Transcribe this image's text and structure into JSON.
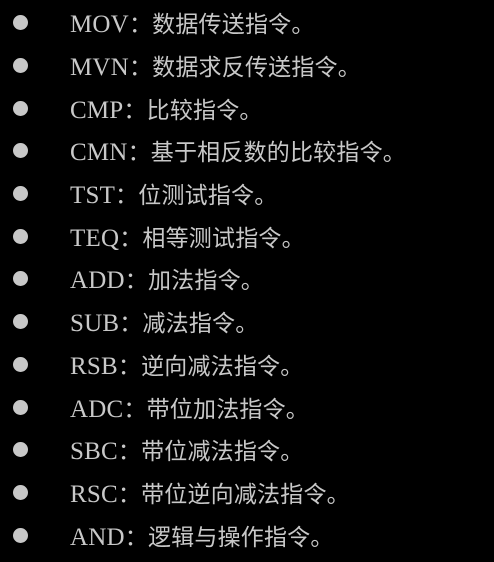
{
  "colors": {
    "background": "#000000",
    "text": "#c8c8c8",
    "bullet": "#c8c8c8"
  },
  "items": [
    {
      "mnemonic": "MOV",
      "sep": "：",
      "desc": "数据传送指令。"
    },
    {
      "mnemonic": "MVN",
      "sep": "：",
      "desc": "数据求反传送指令。"
    },
    {
      "mnemonic": "CMP",
      "sep": "：",
      "desc": "比较指令。"
    },
    {
      "mnemonic": "CMN",
      "sep": "：",
      "desc": "基于相反数的比较指令。"
    },
    {
      "mnemonic": "TST",
      "sep": "：",
      "desc": "位测试指令。"
    },
    {
      "mnemonic": "TEQ",
      "sep": "：",
      "desc": "相等测试指令。"
    },
    {
      "mnemonic": "ADD",
      "sep": "：",
      "desc": "加法指令。"
    },
    {
      "mnemonic": "SUB",
      "sep": "：",
      "desc": "减法指令。"
    },
    {
      "mnemonic": "RSB",
      "sep": "：",
      "desc": "逆向减法指令。"
    },
    {
      "mnemonic": "ADC",
      "sep": "：",
      "desc": "带位加法指令。"
    },
    {
      "mnemonic": "SBC",
      "sep": "：",
      "desc": "带位减法指令。"
    },
    {
      "mnemonic": "RSC",
      "sep": "：",
      "desc": "带位逆向减法指令。"
    },
    {
      "mnemonic": "AND",
      "sep": "：",
      "desc": "逻辑与操作指令。"
    }
  ]
}
